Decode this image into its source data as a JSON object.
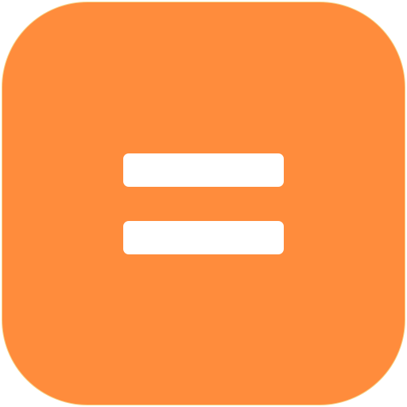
{
  "icon": {
    "name": "equals-icon",
    "background_color": "#FF8C3C",
    "border_color": "#F5D488",
    "symbol_color": "#FFFFFF"
  }
}
